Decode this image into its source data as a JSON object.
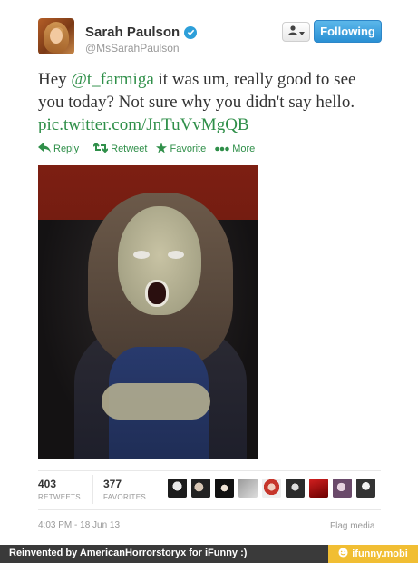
{
  "profile": {
    "name": "Sarah Paulson",
    "username": "@MsSarahPaulson",
    "verified_icon": "verified-check-icon",
    "following_label": "Following"
  },
  "tweet": {
    "text_before": "Hey ",
    "mention": "@t_farmiga",
    "text_middle": " it was um, really good to see you today? Not sure why you didn't say hello. ",
    "link": "pic.twitter.com/JnTuVvMgQB"
  },
  "actions": [
    {
      "label": "Reply",
      "icon": "reply-icon"
    },
    {
      "label": "Retweet",
      "icon": "retweet-icon"
    },
    {
      "label": "Favorite",
      "icon": "star-icon"
    },
    {
      "label": "More",
      "icon": "more-dots-icon"
    }
  ],
  "stats": {
    "retweets": {
      "count": "403",
      "label": "RETWEETS"
    },
    "favorites": {
      "count": "377",
      "label": "FAVORITES"
    }
  },
  "timestamp": "4:03 PM - 18 Jun 13",
  "flag_media": "Flag media",
  "footer": {
    "text": "Reinvented by AmericanHorrorstoryx for iFunny :)",
    "badge": "ifunny.mobi"
  },
  "colors": {
    "link_green": "#2f8f49",
    "following_blue": "#2a90d4",
    "verified_blue": "#2d9fd9",
    "ifunny_yellow": "#f1be33",
    "footer_gray": "#3a3a3a"
  }
}
